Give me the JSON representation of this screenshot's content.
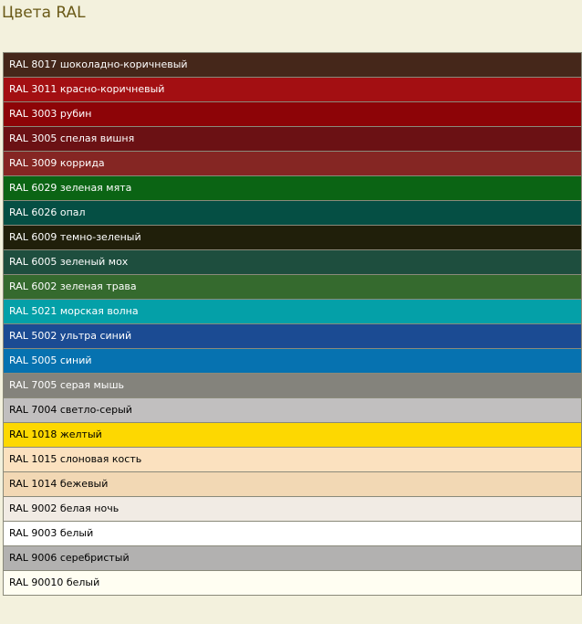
{
  "page": {
    "title": "Цвета RAL"
  },
  "colors": [
    {
      "label": "RAL 8017 шоколадно-коричневый",
      "bg": "#45271a",
      "fg": "#ffffff"
    },
    {
      "label": "RAL 3011 красно-коричневый",
      "bg": "#a30f12",
      "fg": "#ffffff"
    },
    {
      "label": "RAL 3003 рубин",
      "bg": "#8d0407",
      "fg": "#ffffff"
    },
    {
      "label": "RAL 3005 спелая вишня",
      "bg": "#6b1114",
      "fg": "#ffffff"
    },
    {
      "label": "RAL 3009 коррида",
      "bg": "#852623",
      "fg": "#ffffff"
    },
    {
      "label": "RAL 6029 зеленая мята",
      "bg": "#0b6414",
      "fg": "#ffffff"
    },
    {
      "label": "RAL 6026 опал",
      "bg": "#054f44",
      "fg": "#ffffff"
    },
    {
      "label": "RAL 6009 темно-зеленый",
      "bg": "#201f0a",
      "fg": "#ffffff"
    },
    {
      "label": "RAL 6005 зеленый мох",
      "bg": "#1e4e3e",
      "fg": "#ffffff"
    },
    {
      "label": "RAL 6002 зеленая трава",
      "bg": "#356a2e",
      "fg": "#ffffff"
    },
    {
      "label": "RAL 5021 морская волна",
      "bg": "#04a0a8",
      "fg": "#ffffff"
    },
    {
      "label": "RAL 5002 ультра синий",
      "bg": "#1b4b93",
      "fg": "#ffffff"
    },
    {
      "label": "RAL 5005 синий",
      "bg": "#0672b0",
      "fg": "#ffffff"
    },
    {
      "label": "RAL 7005 серая мышь",
      "bg": "#84837c",
      "fg": "#ffffff"
    },
    {
      "label": "RAL 7004 светло-серый",
      "bg": "#c1bfbf",
      "fg": "#000000"
    },
    {
      "label": "RAL 1018 желтый",
      "bg": "#fdd801",
      "fg": "#000000"
    },
    {
      "label": "RAL 1015 слоновая кость",
      "bg": "#fbe1bf",
      "fg": "#000000"
    },
    {
      "label": "RAL 1014 бежевый",
      "bg": "#f2d8b4",
      "fg": "#000000"
    },
    {
      "label": "RAL 9002 белая ночь",
      "bg": "#f1ebe4",
      "fg": "#000000"
    },
    {
      "label": "RAL 9003 белый",
      "bg": "#ffffff",
      "fg": "#000000"
    },
    {
      "label": "RAL 9006 серебристый",
      "bg": "#b2b1b0",
      "fg": "#000000"
    },
    {
      "label": "RAL 90010 белый",
      "bg": "#fffef2",
      "fg": "#000000"
    }
  ]
}
